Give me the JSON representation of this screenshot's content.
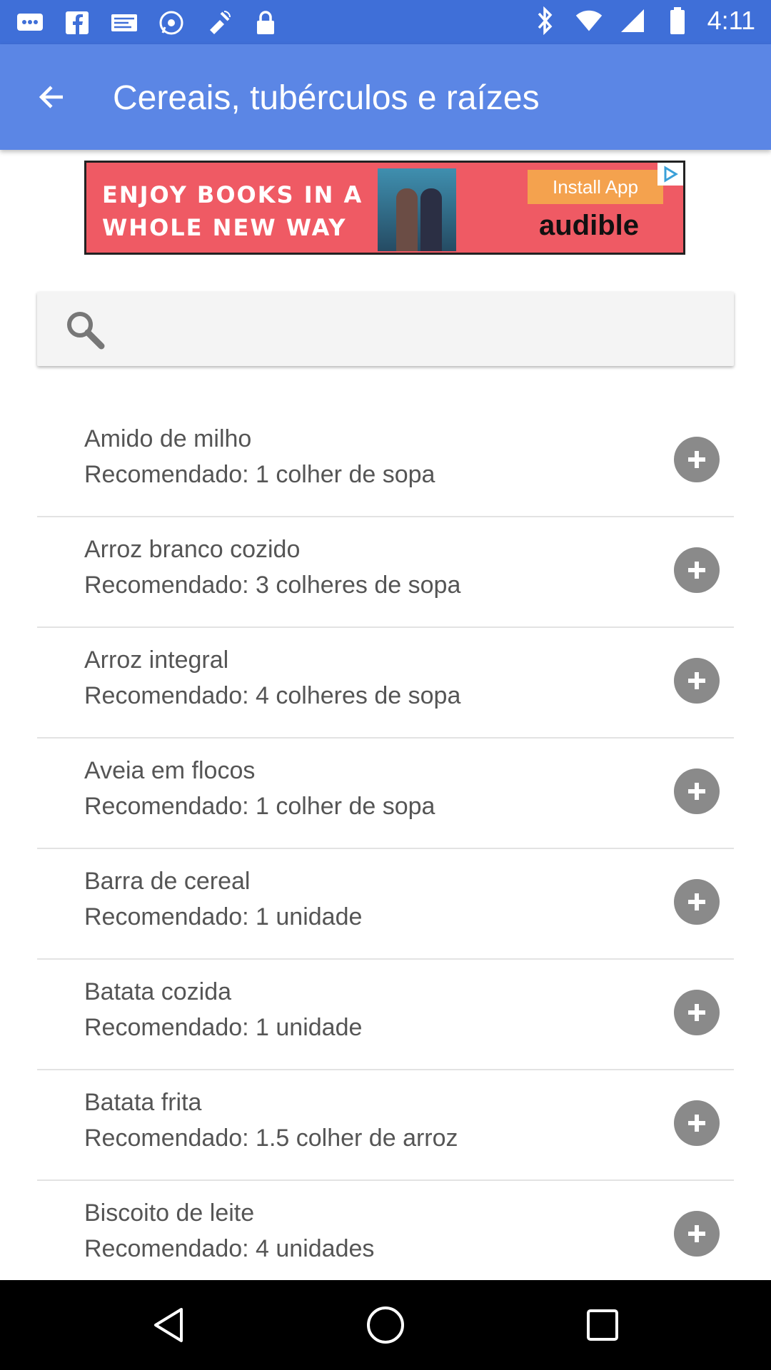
{
  "statusbar": {
    "time": "4:11",
    "left_icons": [
      "message-icon",
      "facebook-icon",
      "mail-icon",
      "whatsapp-icon",
      "mock-location-icon",
      "lock-icon"
    ],
    "right_icons": [
      "bluetooth-icon",
      "wifi-icon",
      "signal-icon",
      "battery-icon"
    ]
  },
  "appbar": {
    "title": "Cereais, tubérculos e raízes",
    "back_icon": "arrow-back-icon"
  },
  "ad": {
    "headline_line1": "ENJOY BOOKS IN A",
    "headline_line2": "WHOLE NEW WAY",
    "cta": "Install App",
    "brand": "audible"
  },
  "search": {
    "value": "",
    "placeholder": "",
    "icon": "search-icon"
  },
  "items": [
    {
      "name": "Amido de milho",
      "recommendation": "Recomendado: 1 colher de sopa"
    },
    {
      "name": "Arroz branco cozido",
      "recommendation": "Recomendado: 3 colheres de sopa"
    },
    {
      "name": "Arroz integral",
      "recommendation": "Recomendado: 4 colheres de sopa"
    },
    {
      "name": "Aveia em flocos",
      "recommendation": "Recomendado: 1 colher de sopa"
    },
    {
      "name": "Barra de cereal",
      "recommendation": "Recomendado: 1 unidade"
    },
    {
      "name": "Batata cozida",
      "recommendation": "Recomendado: 1 unidade"
    },
    {
      "name": "Batata frita",
      "recommendation": "Recomendado: 1.5 colher de arroz"
    },
    {
      "name": "Biscoito de leite",
      "recommendation": "Recomendado: 4 unidades"
    }
  ],
  "navbar": {
    "icons": [
      "back-triangle-icon",
      "home-circle-icon",
      "recents-square-icon"
    ]
  },
  "colors": {
    "statusbar": "#3f6fd8",
    "appbar": "#5b86e5",
    "add_button": "#8a8a8a",
    "text": "#555555"
  }
}
